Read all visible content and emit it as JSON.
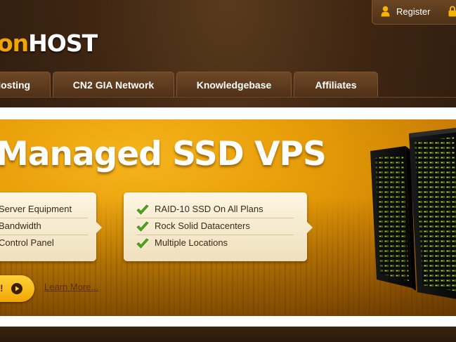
{
  "header": {
    "logo_part_a": "on",
    "logo_part_b": "HOST",
    "register_label": "Register",
    "register_icon": "user-icon",
    "login_icon": "lock-icon"
  },
  "nav": {
    "tabs": [
      {
        "label": "Hosting"
      },
      {
        "label": "CN2 GIA Network"
      },
      {
        "label": "Knowledgebase"
      },
      {
        "label": "Affiliates"
      }
    ]
  },
  "banner": {
    "headline": "Managed SSD VPS",
    "features_left": [
      "Server Equipment",
      "Bandwidth",
      "Control Panel"
    ],
    "features_right": [
      "RAID-10 SSD On All Plans",
      "Rock Solid Datacenters",
      "Multiple Locations"
    ],
    "cta_label": "!",
    "learn_more": "Learn More..."
  },
  "colors": {
    "accent": "#f0a400",
    "nav_bg": "#5e3c1f",
    "banner_orange": "#e59b07"
  }
}
